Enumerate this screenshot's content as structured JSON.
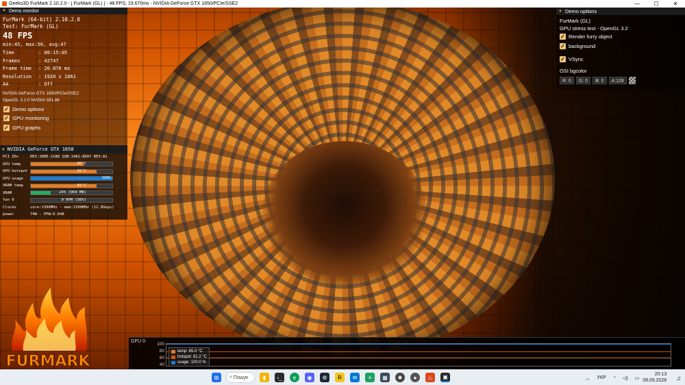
{
  "window": {
    "title": "Geeks3D FurMark 2.10.2.0 - [ FurMark (GL) ] - 48 FPS, 19.670ms - NVIDIA GeForce GTX 1650/PCIe/SSE2",
    "minimize": "—",
    "maximize": "☐",
    "close": "✕"
  },
  "demo_monitor": {
    "header": "Demo monitor",
    "app": "FurMark (64-bit) 2.10.2.0",
    "test": "Test: FurMark (GL)",
    "fps": "48 FPS",
    "fps_stats": "min:45, max:50, avg:47",
    "stats": [
      {
        "key": "Time",
        "value": ": 00:15:05"
      },
      {
        "key": "Frames",
        "value": ": 42747"
      },
      {
        "key": "Frame time",
        "value": ": 20.876 ms"
      },
      {
        "key": "Resolution",
        "value": ": 1920 x 1061"
      },
      {
        "key": "AA",
        "value": ": Off"
      }
    ],
    "gpu_name": "NVIDIA GeForce GTX 1650/PCIe/SSE2",
    "gl_version": "OpenGL 3.2.0 NVIDIA 591.86",
    "options": [
      {
        "label": "Demo options",
        "checked": true
      },
      {
        "label": "GPU monitoring",
        "checked": true
      },
      {
        "label": "GPU graphs",
        "checked": true
      }
    ]
  },
  "gpu_monitor": {
    "header": "NVIDIA GeForce GTX 1650",
    "pci_label": "PCI IDs",
    "pci_value": "DEV:10DE-2188 SUB:1462-8D97 REV:A1",
    "rows": [
      {
        "label": "GPU temp",
        "value": "65°C",
        "fill": 0.65,
        "color": "orange"
      },
      {
        "label": "GPU hotspot",
        "value": "81°C",
        "fill": 0.81,
        "color": "orange"
      },
      {
        "label": "GPU usage",
        "value": "100%",
        "fill": 1.0,
        "color": "blue"
      },
      {
        "label": "VRAM temp",
        "value": "81°C",
        "fill": 0.81,
        "color": "orange"
      },
      {
        "label": "VRAM",
        "value": "24% (964 MB)",
        "fill": 0.24,
        "color": "green"
      },
      {
        "label": "fan 0",
        "value": "0 RPM (56%)",
        "fill": 0.0,
        "color": "orange"
      }
    ],
    "clocks_label": "Clocks",
    "clocks_value": "core:1396MHz - mem:1500MHz (12.0Gbps)",
    "power_label": "power",
    "power_value": "74W - PPW:0.648"
  },
  "logo": {
    "text": "FURMARK"
  },
  "demo_options": {
    "header": "Demo options",
    "name": "FurMark (GL)",
    "desc": "GPU stress test - OpenGL 3.2",
    "options": [
      {
        "label": "Render furry object",
        "checked": true
      },
      {
        "label": "background",
        "checked": true
      }
    ],
    "vsync": {
      "label": "VSync",
      "checked": true
    },
    "bgcolor_label": "OSI bgcolor",
    "rgba": [
      "R: 0",
      "G: 0",
      "B: 0",
      "A:128"
    ]
  },
  "graph": {
    "title": "GPU 0",
    "ticks": [
      "100",
      "80",
      "60",
      "40"
    ],
    "legend": [
      {
        "label": "temp: 65.0 °C",
        "color": "#e67e22"
      },
      {
        "label": "hotspot: 81.2 °C",
        "color": "#d35400"
      },
      {
        "label": "usage: 100.0 %",
        "color": "#1a7fd8"
      }
    ],
    "series": [
      {
        "name": "temp",
        "value": 65
      },
      {
        "name": "hotspot",
        "value": 81.2
      },
      {
        "name": "usage",
        "value": 100
      }
    ]
  },
  "taskbar": {
    "search_label": "Пошук",
    "lang": "УКР",
    "time": "20:13",
    "date": "09.09.2026"
  },
  "colors": {
    "accent": "#f0a040",
    "checkbox": "#f0c27a"
  }
}
